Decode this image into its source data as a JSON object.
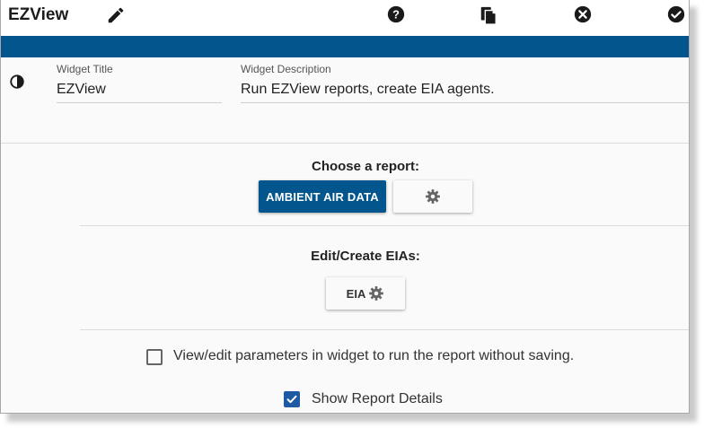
{
  "app": {
    "title": "EZView"
  },
  "toolbar": {
    "edit_icon": "pencil-icon",
    "help_icon": "help-circle-icon",
    "copy_icon": "copy-icon",
    "close_icon": "close-circle-icon",
    "confirm_icon": "check-circle-icon"
  },
  "colors": {
    "accent": "#02568d",
    "checkbox": "#1e5aa3"
  },
  "widget": {
    "title_label": "Widget Title",
    "title_value": "EZView",
    "description_label": "Widget Description",
    "description_value": "Run EZView reports, create EIA agents."
  },
  "report": {
    "heading": "Choose a report:",
    "primary_button": "AMBIENT AIR DATA",
    "settings_icon": "gear-icon"
  },
  "eia": {
    "heading": "Edit/Create EIAs:",
    "button_label": "EIA"
  },
  "options": {
    "run_without_saving": {
      "label": "View/edit parameters in widget to run the report without saving.",
      "checked": false
    },
    "show_details": {
      "label": "Show Report Details",
      "checked": true
    }
  }
}
